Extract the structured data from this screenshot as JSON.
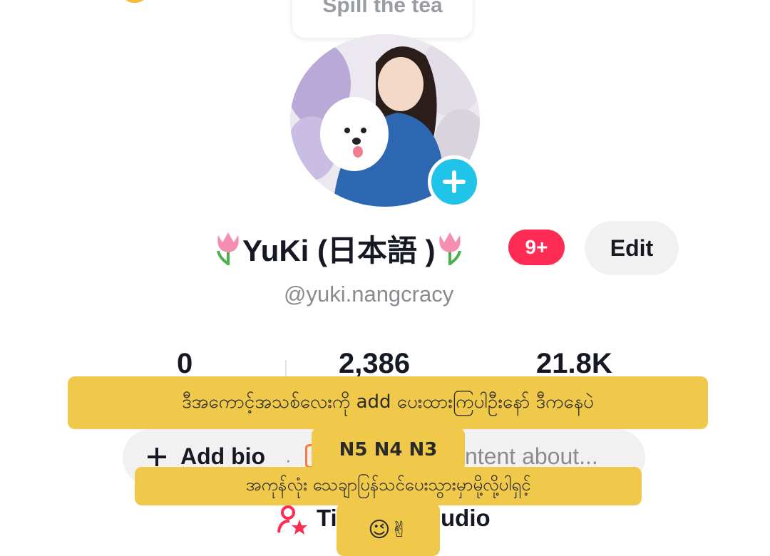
{
  "header": {
    "bubble_text": "Spill the tea"
  },
  "profile": {
    "name": "YuKi (日本語 )",
    "notification_count": "9+",
    "edit_label": "Edit",
    "handle": "@yuki.nangcracy"
  },
  "stats": [
    {
      "value": "0"
    },
    {
      "value": "2,386"
    },
    {
      "value": "21.8K"
    }
  ],
  "bio": {
    "add_label": "Add bio",
    "separator": "·",
    "right_text": "ntent about..."
  },
  "studio": {
    "left_text": "Ti",
    "right_text": "udio"
  },
  "overlay": {
    "line1": "ဒီအကောင့်အသစ်လေးကို add ပေးထားကြပါဦးနော် ဒီကနေပဲ",
    "line2": "N5 N4 N3",
    "line3": "အကုန်လုံး သေချာပြန်သင်ပေးသွားမှာမို့လို့ပါရှင့်",
    "line4": "😉✌"
  },
  "colors": {
    "accent": "#fe2c55",
    "add_badge": "#20c4e9",
    "overlay_yellow": "#f0c94a"
  }
}
